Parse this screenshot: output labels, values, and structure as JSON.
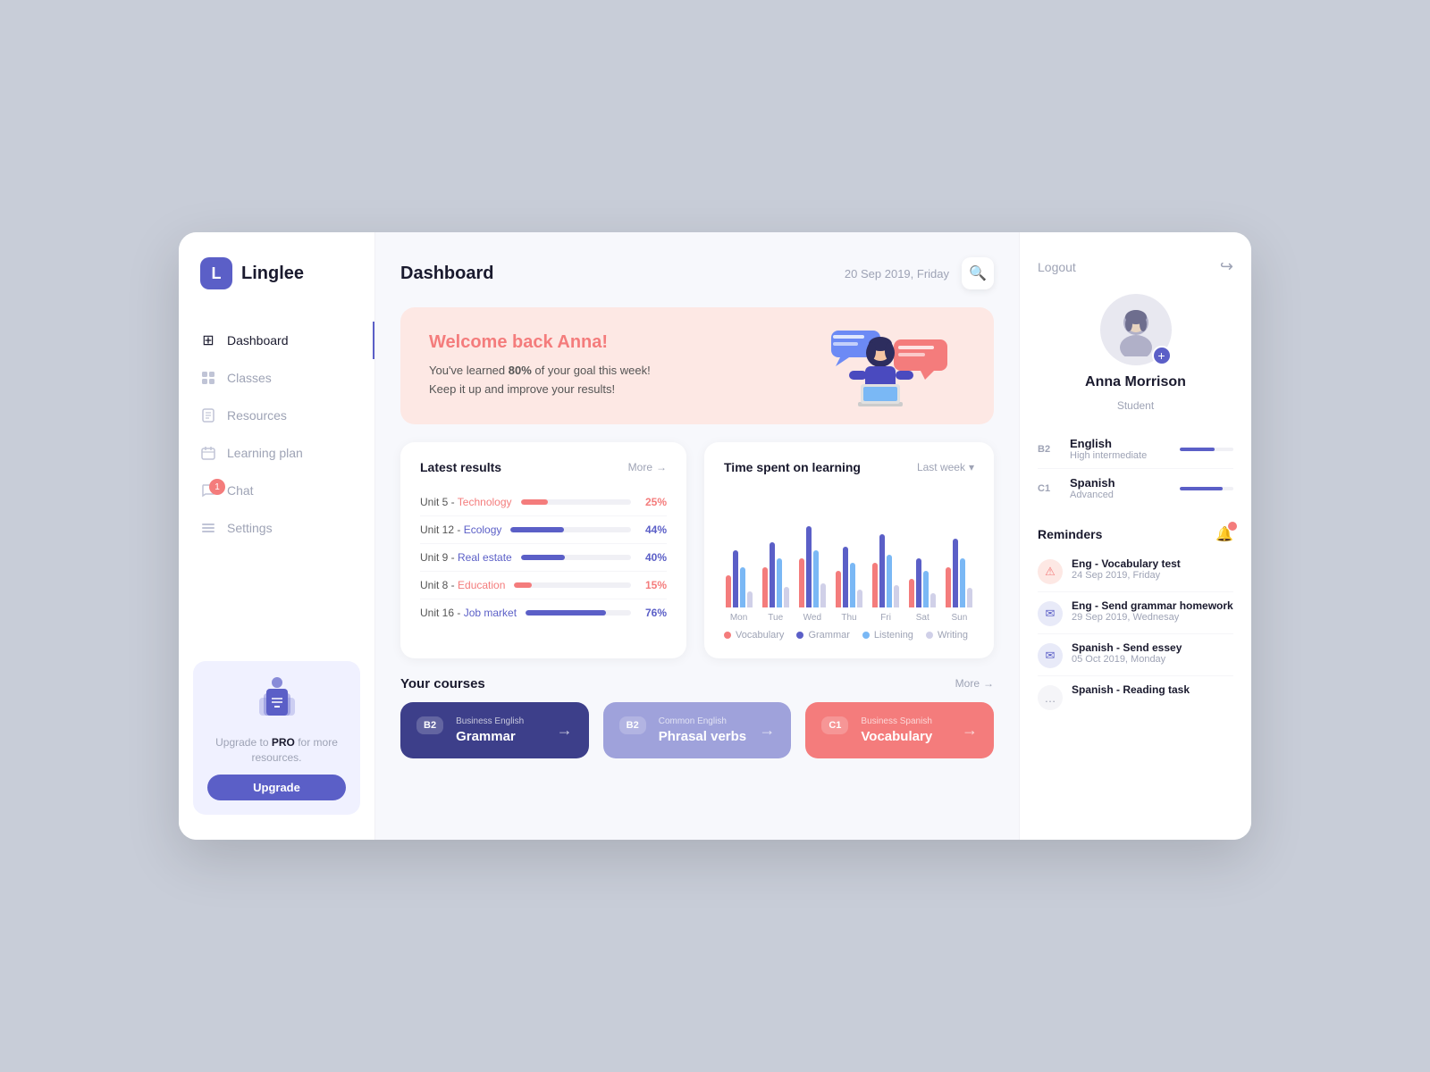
{
  "app": {
    "logo_letter": "L",
    "logo_name": "Linglee"
  },
  "sidebar": {
    "items": [
      {
        "id": "dashboard",
        "label": "Dashboard",
        "icon": "⊞",
        "active": true
      },
      {
        "id": "classes",
        "label": "Classes",
        "icon": "📁",
        "active": false
      },
      {
        "id": "resources",
        "label": "Resources",
        "icon": "📋",
        "active": false
      },
      {
        "id": "learning-plan",
        "label": "Learning plan",
        "icon": "📅",
        "active": false
      },
      {
        "id": "chat",
        "label": "Chat",
        "icon": "💬",
        "active": false,
        "badge": "1"
      },
      {
        "id": "settings",
        "label": "Settings",
        "icon": "✏️",
        "active": false
      }
    ],
    "upgrade": {
      "text_pre": "Upgrade to ",
      "text_bold": "PRO",
      "text_post": " for more resources.",
      "button_label": "Upgrade"
    }
  },
  "header": {
    "title": "Dashboard",
    "date": "20 Sep 2019, Friday",
    "search_placeholder": "Search..."
  },
  "welcome": {
    "title": "Welcome back Anna!",
    "line1_pre": "You've learned ",
    "line1_bold": "80%",
    "line1_post": " of your goal this week!",
    "line2": "Keep it up and improve your results!"
  },
  "latest_results": {
    "title": "Latest results",
    "more_label": "More",
    "items": [
      {
        "unit": "Unit 5",
        "topic": "Technology",
        "pct": 25,
        "color": "#f47c7c"
      },
      {
        "unit": "Unit 12",
        "topic": "Ecology",
        "pct": 44,
        "color": "#5b5fc7"
      },
      {
        "unit": "Unit 9",
        "topic": "Real estate",
        "pct": 40,
        "color": "#5b5fc7"
      },
      {
        "unit": "Unit 8",
        "topic": "Education",
        "pct": 15,
        "color": "#f47c7c"
      },
      {
        "unit": "Unit 16",
        "topic": "Job market",
        "pct": 76,
        "color": "#5b5fc7"
      }
    ]
  },
  "time_chart": {
    "title": "Time spent on learning",
    "filter_label": "Last week",
    "days": [
      {
        "label": "Mon",
        "vocab": 40,
        "grammar": 70,
        "listening": 50,
        "writing": 20
      },
      {
        "label": "Tue",
        "vocab": 50,
        "grammar": 80,
        "listening": 60,
        "writing": 25
      },
      {
        "label": "Wed",
        "vocab": 60,
        "grammar": 100,
        "listening": 70,
        "writing": 30
      },
      {
        "label": "Thu",
        "vocab": 45,
        "grammar": 75,
        "listening": 55,
        "writing": 22
      },
      {
        "label": "Fri",
        "vocab": 55,
        "grammar": 90,
        "listening": 65,
        "writing": 28
      },
      {
        "label": "Sat",
        "vocab": 35,
        "grammar": 60,
        "listening": 45,
        "writing": 18
      },
      {
        "label": "Sun",
        "vocab": 50,
        "grammar": 85,
        "listening": 60,
        "writing": 24
      }
    ],
    "legend": [
      {
        "label": "Vocabulary",
        "color": "#f47c7c"
      },
      {
        "label": "Grammar",
        "color": "#5b5fc7"
      },
      {
        "label": "Listening",
        "color": "#7ab8f5"
      },
      {
        "label": "Writing",
        "color": "#d0d0e8"
      }
    ]
  },
  "courses": {
    "section_title": "Your courses",
    "more_label": "More",
    "items": [
      {
        "badge": "B2",
        "category": "Business English",
        "name": "Grammar",
        "style": "dark"
      },
      {
        "badge": "B2",
        "category": "Common English",
        "name": "Phrasal verbs",
        "style": "light"
      },
      {
        "badge": "C1",
        "category": "Business Spanish",
        "name": "Vocabulary",
        "style": "coral"
      }
    ]
  },
  "right_panel": {
    "logout_label": "Logout",
    "profile": {
      "name": "Anna Morrison",
      "role": "Student"
    },
    "languages": [
      {
        "level": "B2",
        "name": "English",
        "sub": "High intermediate",
        "bar_pct": 65
      },
      {
        "level": "C1",
        "name": "Spanish",
        "sub": "Advanced",
        "bar_pct": 80
      }
    ],
    "reminders": {
      "title": "Reminders",
      "items": [
        {
          "icon": "⚠",
          "icon_style": "red",
          "title": "Eng - Vocabulary test",
          "date": "24 Sep 2019, Friday"
        },
        {
          "icon": "✉",
          "icon_style": "blue",
          "title": "Eng - Send grammar homework",
          "date": "29 Sep 2019, Wednesay"
        },
        {
          "icon": "✉",
          "icon_style": "blue",
          "title": "Spanish - Send essey",
          "date": "05 Oct 2019, Monday"
        },
        {
          "icon": "…",
          "icon_style": "gray",
          "title": "Spanish - Reading task",
          "date": ""
        }
      ]
    }
  }
}
